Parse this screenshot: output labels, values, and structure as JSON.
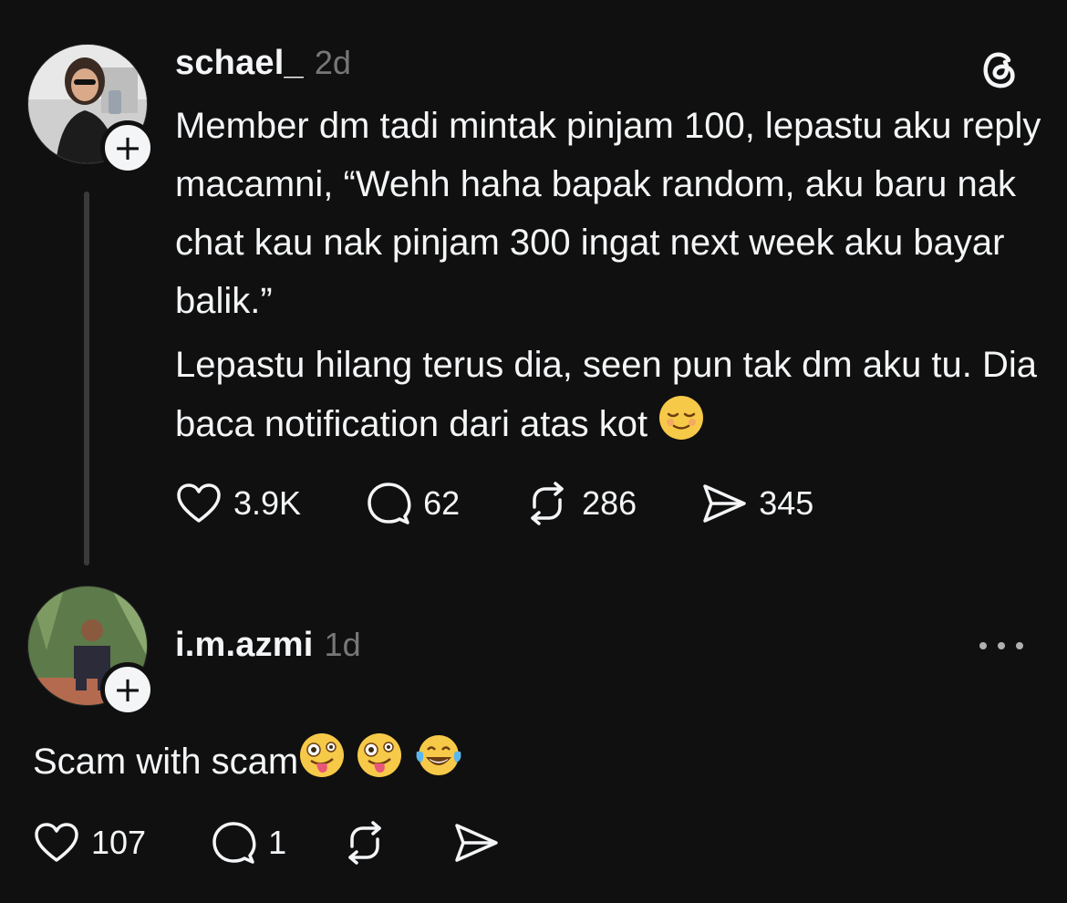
{
  "post": {
    "username": "schael_",
    "time": "2d",
    "paragraph1": "Member dm tadi mintak pinjam 100, lepastu aku reply macamni, “Wehh haha bapak random, aku baru nak chat kau nak pinjam 300 ingat next week aku bayar balik.”",
    "paragraph2": "Lepastu hilang terus dia, seen pun tak dm aku tu. Dia baca notification dari atas kot",
    "likes": "3.9K",
    "comments": "62",
    "reposts": "286",
    "shares": "345",
    "follow_badge": "+"
  },
  "reply": {
    "username": "i.m.azmi",
    "time": "1d",
    "text": "Scam with scam",
    "likes": "107",
    "comments": "1",
    "follow_badge": "+"
  },
  "icons": {
    "app": "threads-logo-icon",
    "like": "heart-icon",
    "comment": "comment-bubble-icon",
    "repost": "repost-icon",
    "share": "send-icon",
    "more": "more-dots-icon"
  },
  "colors": {
    "background": "#101010",
    "text": "#f3f5f7",
    "muted": "#777777",
    "thread_line": "#3a3a3a"
  }
}
